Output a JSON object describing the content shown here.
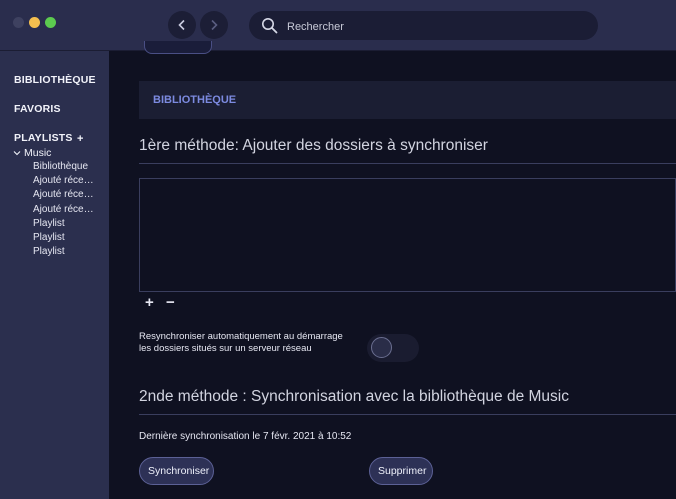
{
  "window": {
    "nav_back": "back",
    "nav_forward": "forward"
  },
  "search": {
    "placeholder": "Rechercher",
    "icon": "magnifier-icon"
  },
  "sidebar": {
    "library": "BIBLIOTHÈQUE",
    "favorites": "FAVORIS",
    "playlists": "PLAYLISTS",
    "playlists_add": "+",
    "music_group": "Music",
    "items": [
      {
        "label": "Bibliothèque"
      },
      {
        "label": "Ajouté récemment"
      },
      {
        "label": "Ajouté récemment"
      },
      {
        "label": "Ajouté récemment"
      },
      {
        "label": "Playlist"
      },
      {
        "label": "Playlist"
      },
      {
        "label": "Playlist"
      }
    ]
  },
  "main": {
    "section_title": "BIBLIOTHÈQUE",
    "method1_title": "1ère méthode: Ajouter des dossiers à synchroniser",
    "add_symbol": "+",
    "remove_symbol": "−",
    "resync_label": "Resynchroniser automatiquement au démarrage les dossiers situés sur un serveur réseau",
    "resync_enabled": false,
    "method2_title": "2nde méthode : Synchronisation avec la bibliothèque de Music",
    "last_sync": "Dernière synchronisation le 7 févr. 2021 à 10:52",
    "sync_button": "Synchroniser",
    "delete_button": "Supprimer"
  },
  "colors": {
    "background": "#0f1121",
    "sidebar": "#2b2f4e",
    "titlebar": "#2a2d4d",
    "accent": "#7c8ae0",
    "traffic_min": "#f5bf4f",
    "traffic_max": "#5ccb4f"
  }
}
